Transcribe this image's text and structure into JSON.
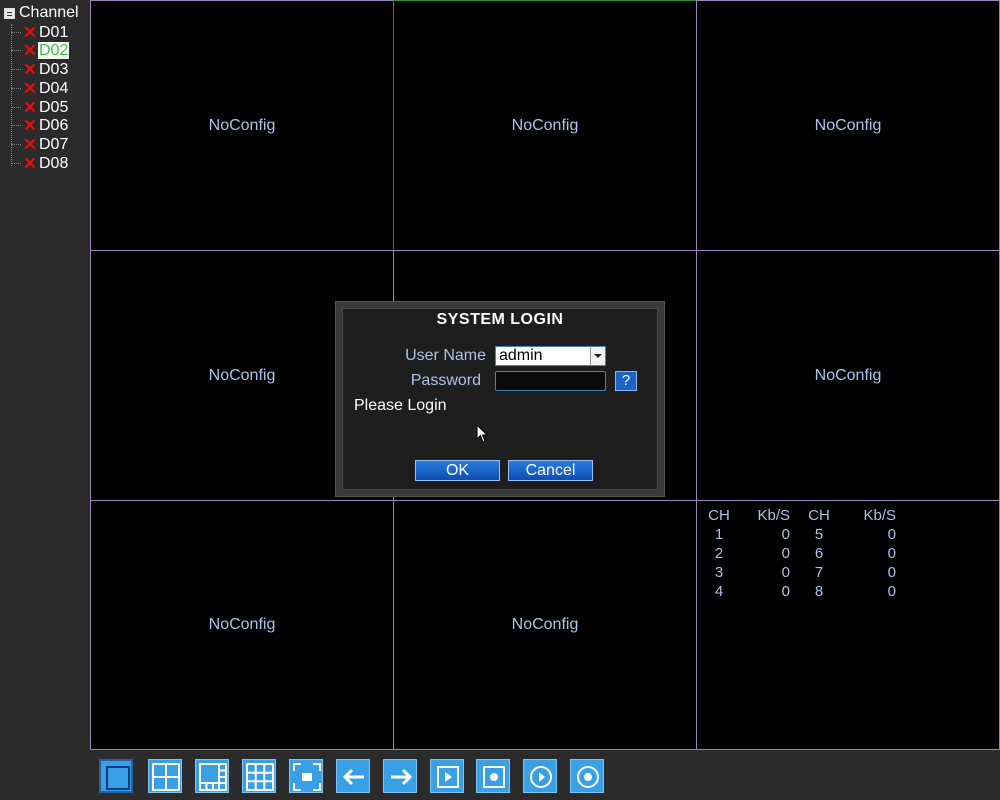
{
  "sidebar": {
    "title": "Channel",
    "channels": [
      {
        "label": "D01",
        "selected": false
      },
      {
        "label": "D02",
        "selected": true
      },
      {
        "label": "D03",
        "selected": false
      },
      {
        "label": "D04",
        "selected": false
      },
      {
        "label": "D05",
        "selected": false
      },
      {
        "label": "D06",
        "selected": false
      },
      {
        "label": "D07",
        "selected": false
      },
      {
        "label": "D08",
        "selected": false
      }
    ]
  },
  "grid": {
    "cells": [
      "NoConfig",
      "NoConfig",
      "NoConfig",
      "NoConfig",
      "",
      "NoConfig",
      "NoConfig",
      "NoConfig",
      ""
    ],
    "active_cell": 1
  },
  "stats": {
    "headers": [
      "CH",
      "Kb/S",
      "CH",
      "Kb/S"
    ],
    "rows": [
      [
        "1",
        "0",
        "5",
        "0"
      ],
      [
        "2",
        "0",
        "6",
        "0"
      ],
      [
        "3",
        "0",
        "7",
        "0"
      ],
      [
        "4",
        "0",
        "8",
        "0"
      ]
    ]
  },
  "login": {
    "title": "SYSTEM LOGIN",
    "user_label": "User Name",
    "user_value": "admin",
    "password_label": "Password",
    "password_value": "",
    "help_label": "?",
    "status": "Please Login",
    "ok_label": "OK",
    "cancel_label": "Cancel"
  },
  "toolbar": {
    "buttons": [
      {
        "name": "view-1-icon"
      },
      {
        "name": "view-4-icon"
      },
      {
        "name": "view-8-icon"
      },
      {
        "name": "view-9-icon"
      },
      {
        "name": "fullscreen-icon"
      },
      {
        "name": "arrow-left-icon"
      },
      {
        "name": "arrow-right-icon"
      },
      {
        "name": "playback-icon"
      },
      {
        "name": "record-icon"
      },
      {
        "name": "play-circle-icon"
      },
      {
        "name": "record-circle-icon"
      }
    ]
  },
  "colors": {
    "cell_border": "#9a84b8",
    "active_border": "#2e8b2e",
    "text_blue": "#a9c4ec",
    "toolbar_button": "#3aa0e6",
    "error_x": "#e01010"
  }
}
